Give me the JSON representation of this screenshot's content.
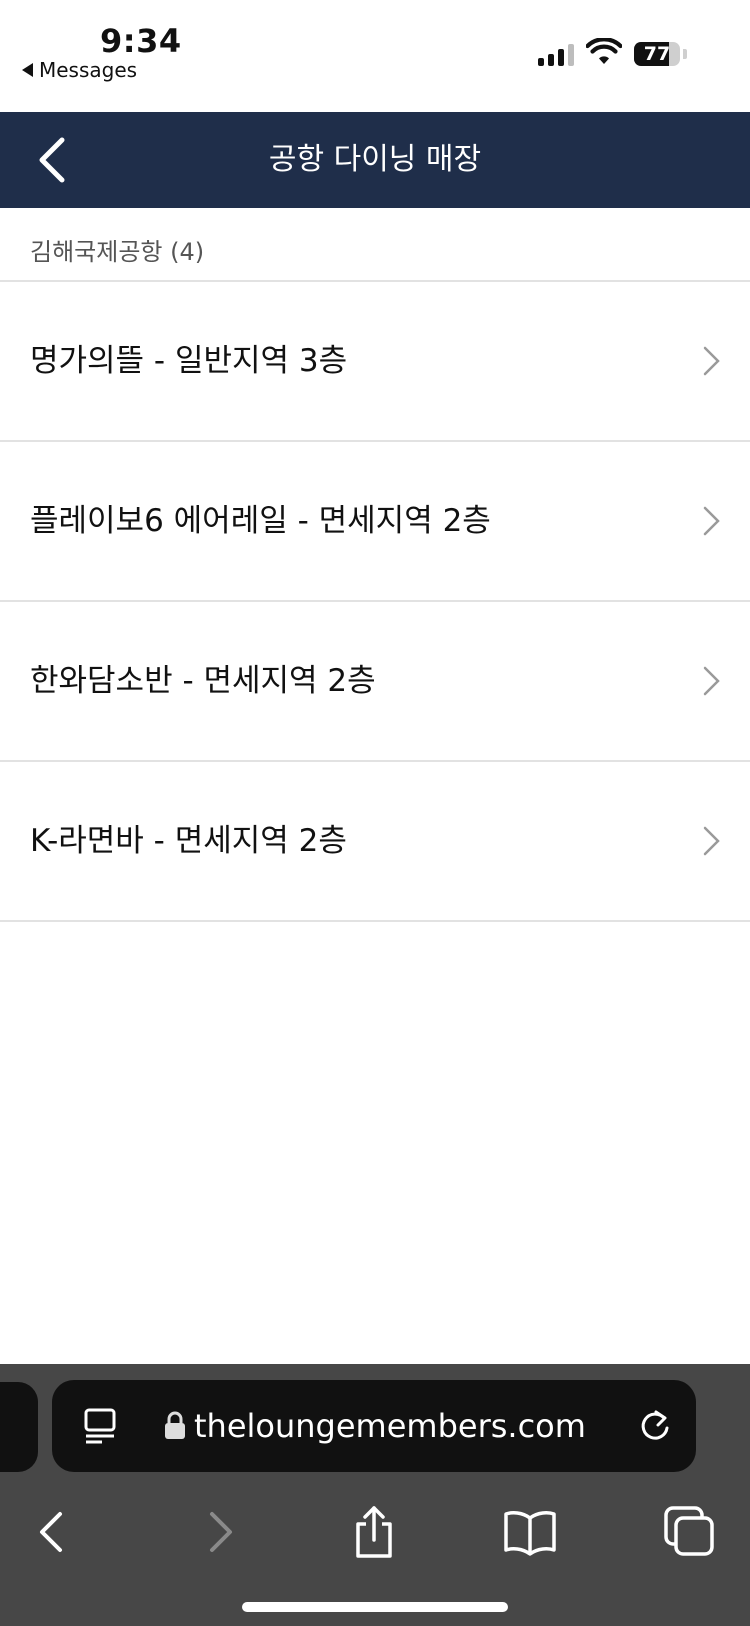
{
  "status_bar": {
    "time": "9:34",
    "back_app": "Messages",
    "battery_percent": "77",
    "battery_level": 0.77
  },
  "header": {
    "title": "공항 다이닝 매장",
    "background": "#1f2e4a"
  },
  "section": {
    "title": "김해국제공항 (4)"
  },
  "items": [
    {
      "label": "명가의뜰 - 일반지역 3층"
    },
    {
      "label": "플레이보6 에어레일 - 면세지역 2층"
    },
    {
      "label": "한와담소반 - 면세지역 2층"
    },
    {
      "label": "K-라면바 - 면세지역 2층"
    }
  ],
  "browser": {
    "url": "theloungemembers.com",
    "icons": [
      "reader-icon",
      "lock-icon",
      "reload-icon",
      "back-icon",
      "forward-icon",
      "share-icon",
      "bookmarks-icon",
      "tabs-icon"
    ]
  }
}
